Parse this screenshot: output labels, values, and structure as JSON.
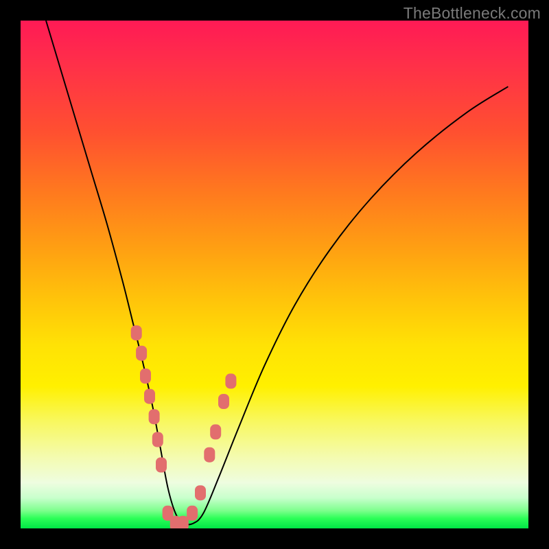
{
  "watermark": "TheBottleneck.com",
  "chart_data": {
    "type": "line",
    "title": "",
    "xlabel": "",
    "ylabel": "",
    "xlim": [
      0,
      100
    ],
    "ylim": [
      0,
      100
    ],
    "grid": false,
    "legend": false,
    "series": [
      {
        "name": "bottleneck-curve",
        "x": [
          5,
          8,
          11,
          14,
          17,
          20,
          22,
          24,
          26,
          27.5,
          29,
          30.5,
          32,
          34,
          36,
          39,
          43,
          48,
          54,
          61,
          69,
          78,
          88,
          96
        ],
        "y": [
          100,
          90,
          80,
          70,
          60,
          49,
          41,
          33,
          24,
          16,
          8,
          3,
          1,
          1,
          3,
          10,
          20,
          32,
          44,
          55,
          65,
          74,
          82,
          87
        ]
      }
    ],
    "markers": {
      "name": "highlighted-points",
      "color": "#e26e6e",
      "x": [
        22.8,
        23.8,
        24.6,
        25.4,
        26.3,
        27.0,
        27.7,
        29.0,
        30.5,
        32.0,
        33.8,
        35.4,
        37.2,
        38.4,
        40.0,
        41.4
      ],
      "y": [
        38.5,
        34.5,
        30.0,
        26.0,
        22.0,
        17.5,
        12.5,
        3.0,
        1.0,
        1.0,
        3.0,
        7.0,
        14.5,
        19.0,
        25.0,
        29.0
      ]
    },
    "background_gradient": {
      "top": "#ff1a55",
      "middle": "#ffe205",
      "bottom": "#00e646"
    }
  }
}
